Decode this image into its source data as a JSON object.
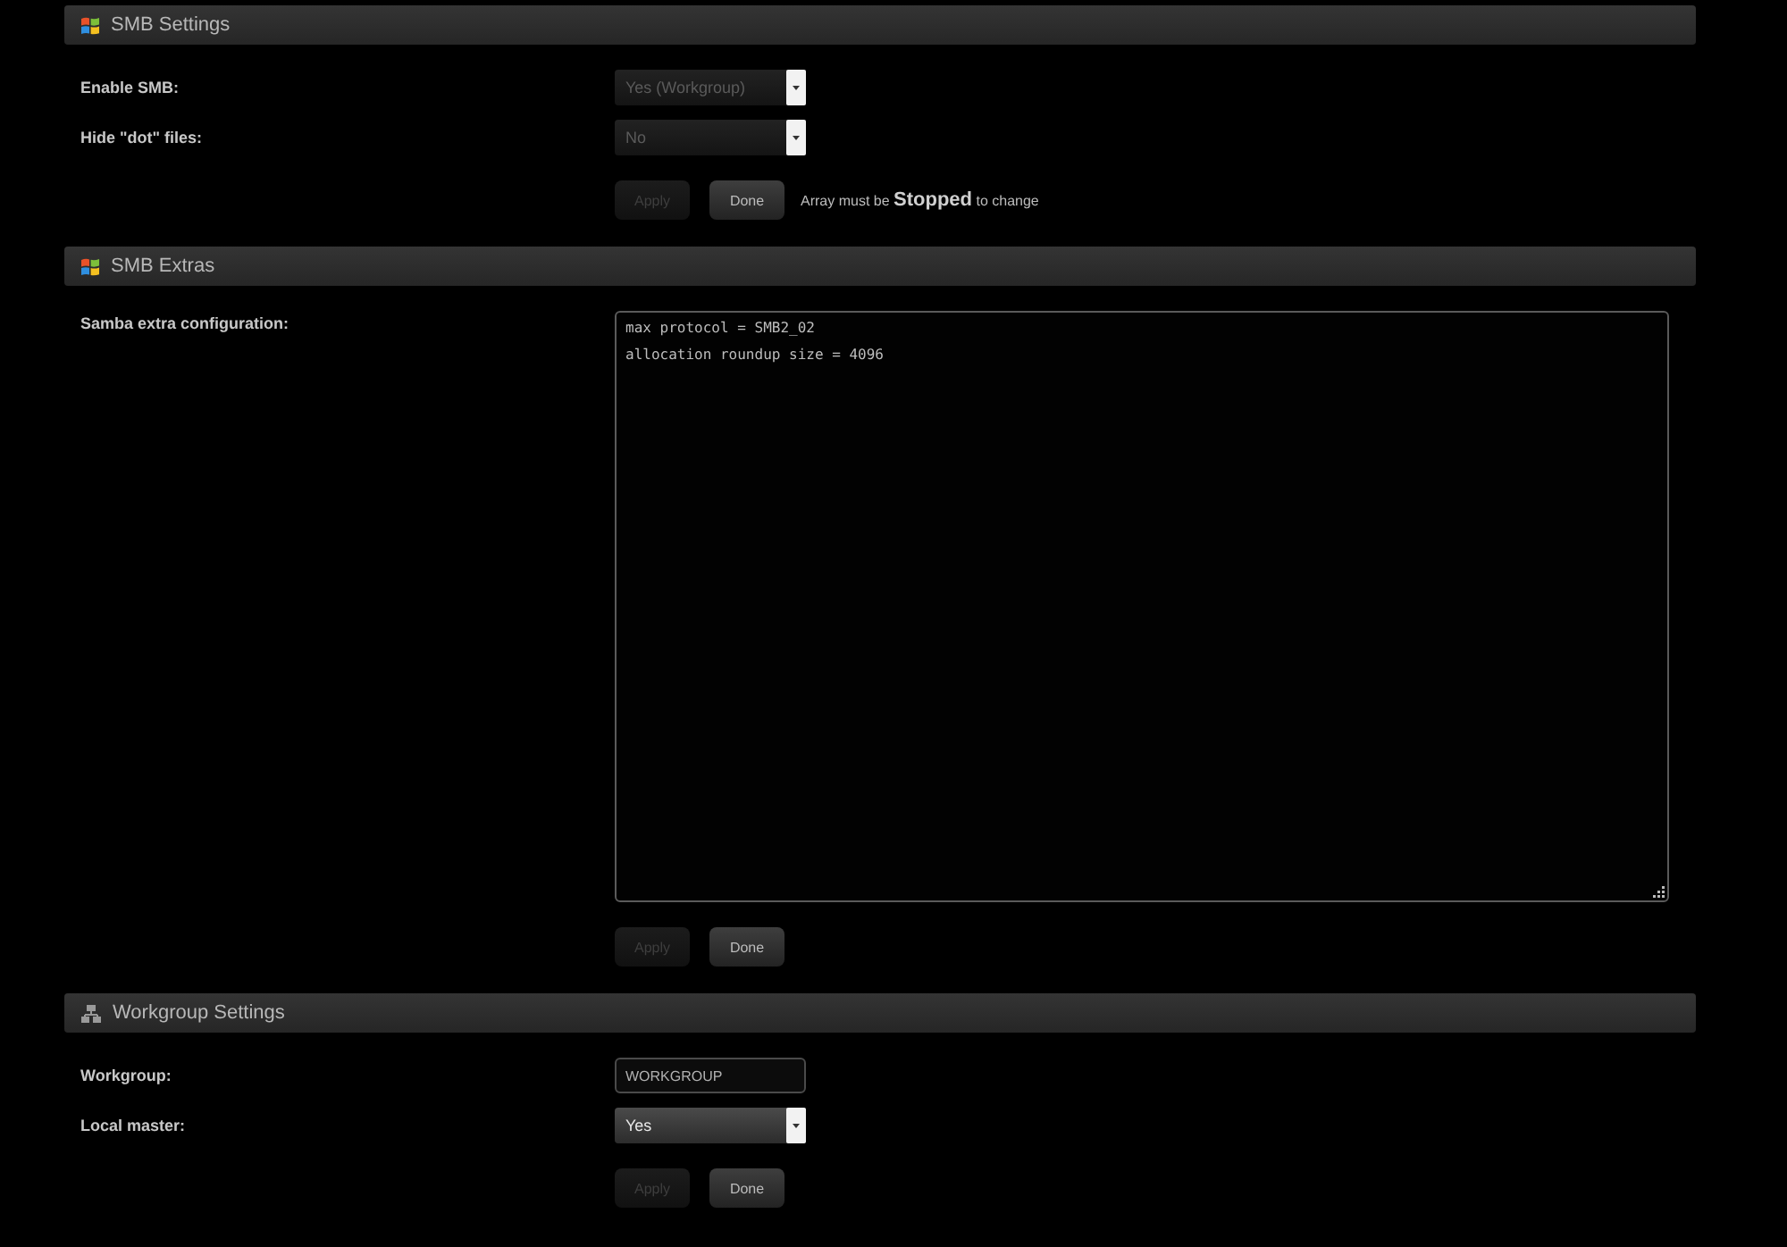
{
  "sections": [
    {
      "title": "SMB Settings",
      "kind": "smb",
      "rows": [
        {
          "kind": "select",
          "label": "Enable SMB:",
          "value": "Yes (Workgroup)",
          "disabled": true
        },
        {
          "kind": "select",
          "label": "Hide \"dot\" files:",
          "value": "No",
          "disabled": true
        }
      ],
      "buttons": [
        {
          "label": "Apply",
          "disabled": true
        },
        {
          "label": "Done",
          "disabled": false
        }
      ],
      "note": "Array must be **Stopped** to change"
    },
    {
      "title": "SMB Extras",
      "kind": "smb",
      "rows": [
        {
          "kind": "textarea",
          "label": "Samba extra configuration:",
          "lines": [
            "max protocol = SMB2_02",
            "allocation roundup size = 4096"
          ]
        }
      ],
      "buttons": [
        {
          "label": "Apply",
          "disabled": true
        },
        {
          "label": "Done",
          "disabled": false
        }
      ]
    },
    {
      "title": "Workgroup Settings",
      "kind": "workgroup",
      "rows": [
        {
          "kind": "text",
          "label": "Workgroup:",
          "value": "WORKGROUP"
        },
        {
          "kind": "select",
          "label": "Local master:",
          "value": "Yes",
          "disabled": false
        }
      ],
      "buttons": [
        {
          "label": "Apply",
          "disabled": true
        },
        {
          "label": "Done",
          "disabled": false
        }
      ]
    }
  ]
}
